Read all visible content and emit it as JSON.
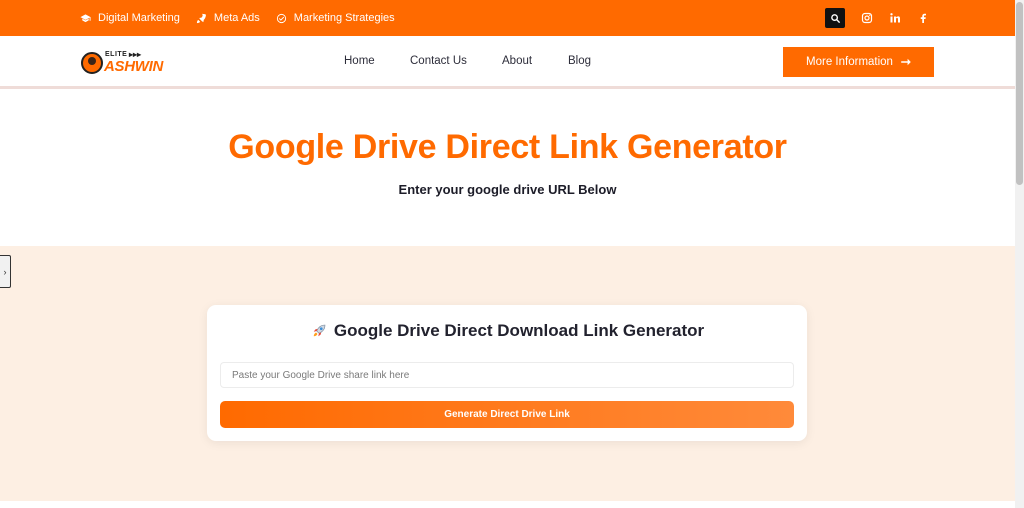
{
  "topbar": {
    "links": [
      {
        "label": "Digital Marketing",
        "icon": "graduation-cap-icon"
      },
      {
        "label": "Meta Ads",
        "icon": "rocket-icon"
      },
      {
        "label": "Marketing Strategies",
        "icon": "check-circle-icon"
      }
    ],
    "social": [
      "instagram-icon",
      "linkedin-icon",
      "facebook-icon"
    ],
    "accent": "#ff6a00"
  },
  "logo": {
    "top": "ELITE",
    "name": "ASHWIN"
  },
  "nav": {
    "items": [
      "Home",
      "Contact Us",
      "About",
      "Blog"
    ],
    "cta": "More Information"
  },
  "hero": {
    "title": "Google Drive Direct Link Generator",
    "subtitle": "Enter your google drive URL Below"
  },
  "tool": {
    "title": "Google Drive Direct Download Link Generator",
    "input_placeholder": "Paste your Google Drive share link here",
    "input_value": "",
    "button_label": "Generate Direct Drive Link",
    "background": "#fdefe3"
  }
}
